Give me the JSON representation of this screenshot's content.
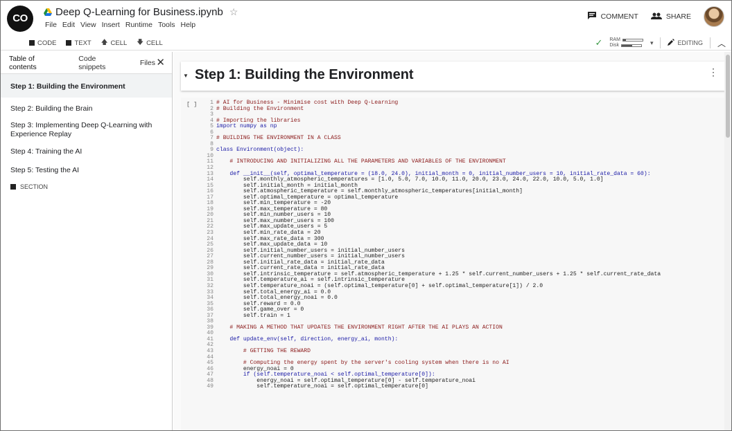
{
  "app": {
    "logo_text": "CO",
    "notebook_title": "Deep Q-Learning for Business.ipynb",
    "star_icon": "star-outline-icon",
    "menu": [
      "File",
      "Edit",
      "View",
      "Insert",
      "Runtime",
      "Tools",
      "Help"
    ],
    "comment_label": "COMMENT",
    "share_label": "SHARE"
  },
  "toolbar": {
    "code_label": "CODE",
    "text_label": "TEXT",
    "cell_up_label": "CELL",
    "cell_down_label": "CELL",
    "ram_label": "RAM",
    "disk_label": "Disk",
    "ram_usage": 0.15,
    "disk_usage": 0.55,
    "editing_label": "EDITING"
  },
  "sidebar": {
    "tabs": [
      "Table of contents",
      "Code snippets",
      "Files"
    ],
    "items": [
      "Step 1: Building the Environment",
      "Step 2: Building the Brain",
      "Step 3: Implementing Deep Q-Learning with Experience Replay",
      "Step 4: Training the AI",
      "Step 5: Testing the AI"
    ],
    "section_label": "SECTION"
  },
  "main": {
    "cell_title": "Step 1: Building the Environment",
    "run_bracket": "[ ]",
    "code_lines": [
      "# AI for Business - Minimise cost with Deep Q-Learning",
      "# Building the Environment",
      "",
      "# Importing the libraries",
      "import numpy as np",
      "",
      "# BUILDING THE ENVIRONMENT IN A CLASS",
      "",
      "class Environment(object):",
      "",
      "    # INTRODUCING AND INITIALIZING ALL THE PARAMETERS AND VARIABLES OF THE ENVIRONMENT",
      "",
      "    def __init__(self, optimal_temperature = (18.0, 24.0), initial_month = 0, initial_number_users = 10, initial_rate_data = 60):",
      "        self.monthly_atmospheric_temperatures = [1.0, 5.0, 7.0, 10.0, 11.0, 20.0, 23.0, 24.0, 22.0, 10.0, 5.0, 1.0]",
      "        self.initial_month = initial_month",
      "        self.atmospheric_temperature = self.monthly_atmospheric_temperatures[initial_month]",
      "        self.optimal_temperature = optimal_temperature",
      "        self.min_temperature = -20",
      "        self.max_temperature = 80",
      "        self.min_number_users = 10",
      "        self.max_number_users = 100",
      "        self.max_update_users = 5",
      "        self.min_rate_data = 20",
      "        self.max_rate_data = 300",
      "        self.max_update_data = 10",
      "        self.initial_number_users = initial_number_users",
      "        self.current_number_users = initial_number_users",
      "        self.initial_rate_data = initial_rate_data",
      "        self.current_rate_data = initial_rate_data",
      "        self.intrinsic_temperature = self.atmospheric_temperature + 1.25 * self.current_number_users + 1.25 * self.current_rate_data",
      "        self.temperature_ai = self.intrinsic_temperature",
      "        self.temperature_noai = (self.optimal_temperature[0] + self.optimal_temperature[1]) / 2.0",
      "        self.total_energy_ai = 0.0",
      "        self.total_energy_noai = 0.0",
      "        self.reward = 0.0",
      "        self.game_over = 0",
      "        self.train = 1",
      "",
      "    # MAKING A METHOD THAT UPDATES THE ENVIRONMENT RIGHT AFTER THE AI PLAYS AN ACTION",
      "",
      "    def update_env(self, direction, energy_ai, month):",
      "",
      "        # GETTING THE REWARD",
      "",
      "        # Computing the energy spent by the server's cooling system when there is no AI",
      "        energy_noai = 0",
      "        if (self.temperature_noai < self.optimal_temperature[0]):",
      "            energy_noai = self.optimal_temperature[0] - self.temperature_noai",
      "            self.temperature_noai = self.optimal_temperature[0]"
    ]
  },
  "colors": {
    "accent": "#ff9800",
    "comment": "#8b1a1a",
    "keyword": "#1a1aa6",
    "saved_check": "#3d9b48"
  }
}
